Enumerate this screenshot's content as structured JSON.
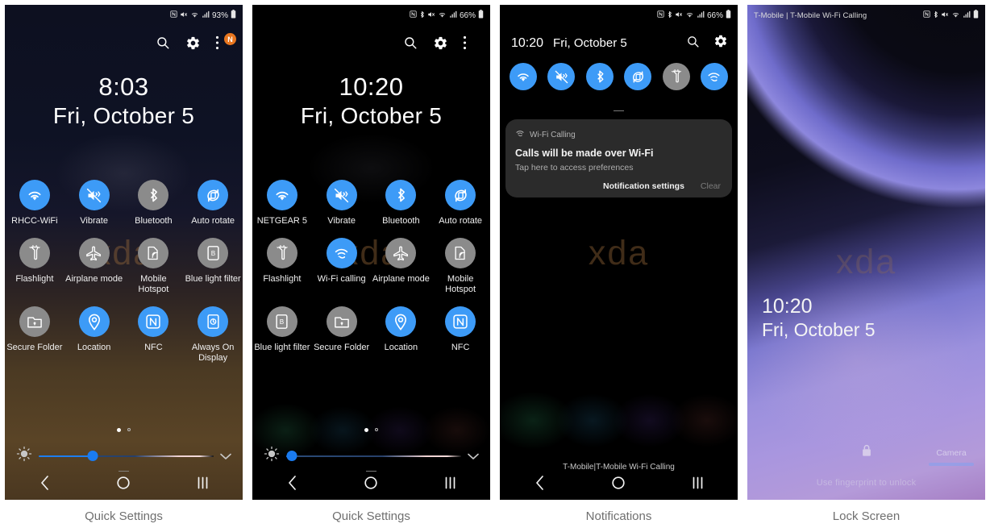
{
  "panels": [
    {
      "caption": "Quick Settings",
      "statusbar": {
        "carrier": "",
        "icons": [
          "nfc-icon",
          "mute-icon",
          "wifi-icon",
          "signal-icon"
        ],
        "battery": "93%"
      },
      "header": {
        "search": "search-icon",
        "settings": "gear-icon",
        "overflow": "overflow-menu-icon",
        "badge": "N"
      },
      "clock": {
        "time": "8:03",
        "date": "Fri, October 5"
      },
      "watermark": "xda",
      "tiles": [
        {
          "label": "RHCC-WiFi",
          "icon": "wifi-icon",
          "state": "on"
        },
        {
          "label": "Vibrate",
          "icon": "vibrate-icon",
          "state": "on"
        },
        {
          "label": "Bluetooth",
          "icon": "bluetooth-icon",
          "state": "off"
        },
        {
          "label": "Auto rotate",
          "icon": "auto-rotate-icon",
          "state": "on"
        },
        {
          "label": "Flashlight",
          "icon": "flashlight-icon",
          "state": "off"
        },
        {
          "label": "Airplane mode",
          "icon": "airplane-icon",
          "state": "off"
        },
        {
          "label": "Mobile Hotspot",
          "icon": "hotspot-icon",
          "state": "off"
        },
        {
          "label": "Blue light filter",
          "icon": "blue-light-icon",
          "state": "off"
        },
        {
          "label": "Secure Folder",
          "icon": "secure-folder-icon",
          "state": "off"
        },
        {
          "label": "Location",
          "icon": "location-icon",
          "state": "on"
        },
        {
          "label": "NFC",
          "icon": "nfc-icon",
          "state": "on"
        },
        {
          "label": "Always On Display",
          "icon": "aod-icon",
          "state": "on"
        }
      ],
      "brightness": {
        "value_pct": 31,
        "icon": "brightness-icon",
        "expand": "chevron-down-icon"
      },
      "pager": {
        "current": 1,
        "total": 2
      },
      "nav": {
        "back": "back-icon",
        "home": "home-icon",
        "recents": "recents-icon"
      }
    },
    {
      "caption": "Quick Settings",
      "statusbar": {
        "carrier": "",
        "icons": [
          "nfc-icon",
          "bluetooth-icon",
          "mute-icon",
          "wifi-icon",
          "signal-icon"
        ],
        "battery": "66%"
      },
      "header": {
        "search": "search-icon",
        "settings": "gear-icon",
        "overflow": "overflow-menu-icon",
        "badge": ""
      },
      "clock": {
        "time": "10:20",
        "date": "Fri, October 5"
      },
      "watermark": "xda",
      "tiles": [
        {
          "label": "NETGEAR 5",
          "icon": "wifi-icon",
          "state": "on"
        },
        {
          "label": "Vibrate",
          "icon": "vibrate-icon",
          "state": "on"
        },
        {
          "label": "Bluetooth",
          "icon": "bluetooth-icon",
          "state": "on"
        },
        {
          "label": "Auto rotate",
          "icon": "auto-rotate-icon",
          "state": "on"
        },
        {
          "label": "Flashlight",
          "icon": "flashlight-icon",
          "state": "off"
        },
        {
          "label": "Wi-Fi calling",
          "icon": "wifi-calling-icon",
          "state": "on"
        },
        {
          "label": "Airplane mode",
          "icon": "airplane-icon",
          "state": "off"
        },
        {
          "label": "Mobile Hotspot",
          "icon": "hotspot-icon",
          "state": "off"
        },
        {
          "label": "Blue light filter",
          "icon": "blue-light-icon",
          "state": "off"
        },
        {
          "label": "Secure Folder",
          "icon": "secure-folder-icon",
          "state": "off"
        },
        {
          "label": "Location",
          "icon": "location-icon",
          "state": "on"
        },
        {
          "label": "NFC",
          "icon": "nfc-icon",
          "state": "on"
        }
      ],
      "brightness": {
        "value_pct": 3,
        "icon": "brightness-icon",
        "expand": "chevron-down-icon"
      },
      "pager": {
        "current": 1,
        "total": 2
      },
      "nav": {
        "back": "back-icon",
        "home": "home-icon",
        "recents": "recents-icon"
      }
    },
    {
      "caption": "Notifications",
      "statusbar": {
        "carrier": "",
        "icons": [
          "nfc-icon",
          "bluetooth-icon",
          "mute-icon",
          "wifi-icon",
          "signal-icon"
        ],
        "battery": "66%"
      },
      "header": {
        "time": "10:20",
        "date": "Fri, October 5",
        "search": "search-icon",
        "settings": "gear-icon"
      },
      "watermark": "xda",
      "mini_tiles": [
        {
          "icon": "wifi-icon",
          "state": "on"
        },
        {
          "icon": "vibrate-icon",
          "state": "on"
        },
        {
          "icon": "bluetooth-icon",
          "state": "on"
        },
        {
          "icon": "auto-rotate-icon",
          "state": "on"
        },
        {
          "icon": "flashlight-icon",
          "state": "off"
        },
        {
          "icon": "wifi-calling-icon",
          "state": "on"
        }
      ],
      "notification": {
        "app_icon": "wifi-calling-icon",
        "app": "Wi-Fi Calling",
        "title": "Calls will be made over Wi-Fi",
        "subtitle": "Tap here to access preferences",
        "primary_action": "Notification settings",
        "secondary_action": "Clear"
      },
      "carrier_footer": "T-Mobile|T-Mobile Wi-Fi Calling",
      "nav": {
        "back": "back-icon",
        "home": "home-icon",
        "recents": "recents-icon"
      }
    },
    {
      "caption": "Lock Screen",
      "statusbar": {
        "carrier": "T-Mobile | T-Mobile Wi-Fi Calling",
        "icons": [
          "nfc-icon",
          "bluetooth-icon",
          "mute-icon",
          "wifi-icon",
          "signal-icon"
        ],
        "battery": ""
      },
      "watermark": "xda",
      "clock": {
        "time": "10:20",
        "date": "Fri, October 5"
      },
      "lock_icon": "lock-icon",
      "camera_label": "Camera",
      "hint": "Use fingerprint to unlock"
    }
  ],
  "colors": {
    "accent_on": "#3d9bf7",
    "accent_off": "#8b8b8b",
    "badge": "#e8761f",
    "slider": "#1a7bef",
    "caption_text": "#6f6f6f"
  }
}
